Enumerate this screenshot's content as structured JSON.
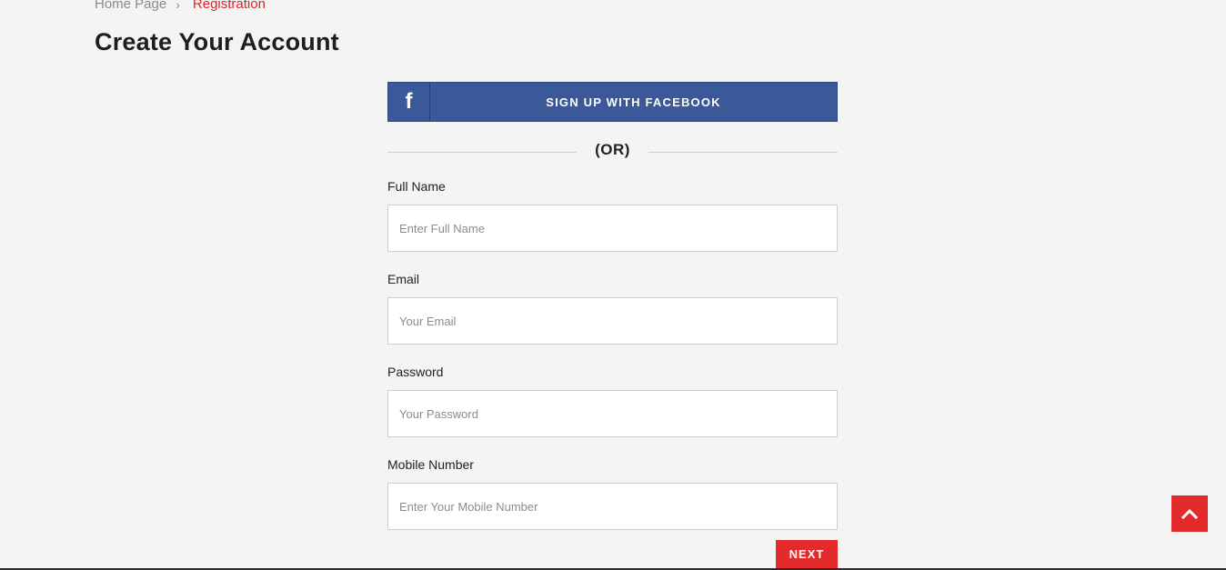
{
  "breadcrumb": {
    "home": "Home Page",
    "separator": "›",
    "current": "Registration"
  },
  "page_title": "Create Your Account",
  "facebook": {
    "icon": "f",
    "label": "SIGN UP WITH FACEBOOK"
  },
  "divider": {
    "text": "(OR)"
  },
  "form": {
    "full_name": {
      "label": "Full Name",
      "placeholder": "Enter Full Name",
      "value": ""
    },
    "email": {
      "label": "Email",
      "placeholder": "Your Email",
      "value": ""
    },
    "password": {
      "label": "Password",
      "placeholder": "Your Password",
      "value": ""
    },
    "mobile": {
      "label": "Mobile Number",
      "placeholder": "Enter Your Mobile Number",
      "value": ""
    }
  },
  "next_button": {
    "label": "NEXT"
  },
  "scroll_top": {
    "icon": "chevron-up-icon"
  },
  "colors": {
    "background": "#f4f4f4",
    "accent_red": "#e32b2b",
    "breadcrumb_active": "#d92626",
    "facebook_blue": "#3b5998"
  }
}
